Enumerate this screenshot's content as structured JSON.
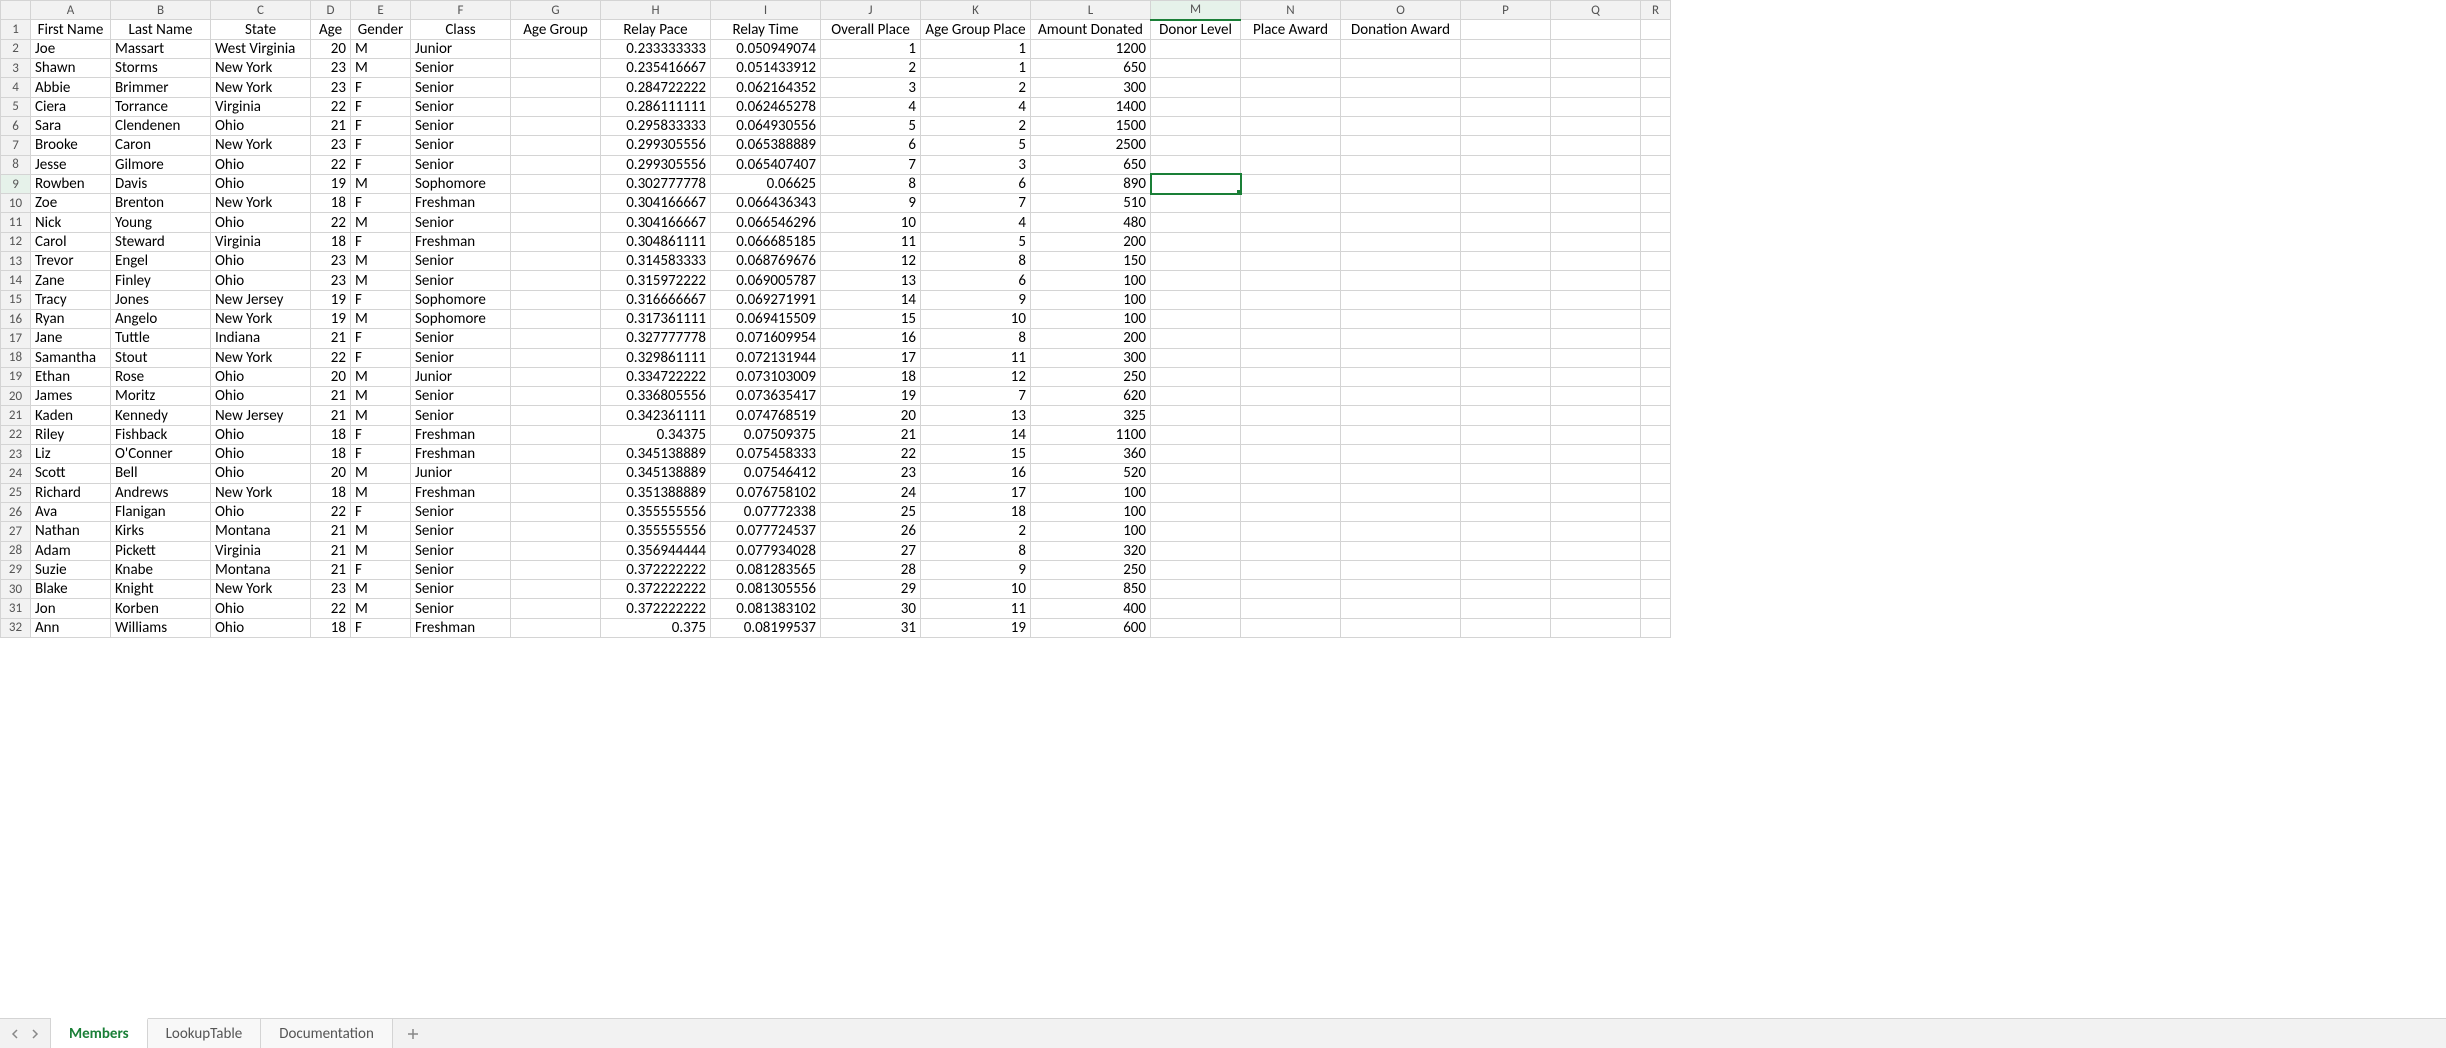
{
  "columns": [
    "A",
    "B",
    "C",
    "D",
    "E",
    "F",
    "G",
    "H",
    "I",
    "J",
    "K",
    "L",
    "M",
    "N",
    "O",
    "P",
    "Q",
    "R"
  ],
  "headers": {
    "A": "First Name",
    "B": "Last Name",
    "C": "State",
    "D": "Age",
    "E": "Gender",
    "F": "Class",
    "G": "Age Group",
    "H": "Relay Pace",
    "I": "Relay Time",
    "J": "Overall Place",
    "K": "Age Group Place",
    "L": "Amount Donated",
    "M": "Donor Level",
    "N": "Place Award",
    "O": "Donation Award",
    "P": "",
    "Q": "",
    "R": ""
  },
  "chart_data": {
    "type": "table",
    "columns": [
      "First Name",
      "Last Name",
      "State",
      "Age",
      "Gender",
      "Class",
      "Age Group",
      "Relay Pace",
      "Relay Time",
      "Overall Place",
      "Age Group Place",
      "Amount Donated",
      "Donor Level",
      "Place Award",
      "Donation Award"
    ],
    "rows": [
      [
        "Joe",
        "Massart",
        "West Virginia",
        20,
        "M",
        "Junior",
        "",
        0.233333333,
        0.050949074,
        1,
        1,
        1200,
        "",
        "",
        ""
      ],
      [
        "Shawn",
        "Storms",
        "New York",
        23,
        "M",
        "Senior",
        "",
        0.235416667,
        0.051433912,
        2,
        1,
        650,
        "",
        "",
        ""
      ],
      [
        "Abbie",
        "Brimmer",
        "New York",
        23,
        "F",
        "Senior",
        "",
        0.284722222,
        0.062164352,
        3,
        2,
        300,
        "",
        "",
        ""
      ],
      [
        "Ciera",
        "Torrance",
        "Virginia",
        22,
        "F",
        "Senior",
        "",
        0.286111111,
        0.062465278,
        4,
        4,
        1400,
        "",
        "",
        ""
      ],
      [
        "Sara",
        "Clendenen",
        "Ohio",
        21,
        "F",
        "Senior",
        "",
        0.295833333,
        0.064930556,
        5,
        2,
        1500,
        "",
        "",
        ""
      ],
      [
        "Brooke",
        "Caron",
        "New York",
        23,
        "F",
        "Senior",
        "",
        0.299305556,
        0.065388889,
        6,
        5,
        2500,
        "",
        "",
        ""
      ],
      [
        "Jesse",
        "Gilmore",
        "Ohio",
        22,
        "F",
        "Senior",
        "",
        0.299305556,
        0.065407407,
        7,
        3,
        650,
        "",
        "",
        ""
      ],
      [
        "Rowben",
        "Davis",
        "Ohio",
        19,
        "M",
        "Sophomore",
        "",
        0.302777778,
        0.06625,
        8,
        6,
        890,
        "",
        "",
        ""
      ],
      [
        "Zoe",
        "Brenton",
        "New York",
        18,
        "F",
        "Freshman",
        "",
        0.304166667,
        0.066436343,
        9,
        7,
        510,
        "",
        "",
        ""
      ],
      [
        "Nick",
        "Young",
        "Ohio",
        22,
        "M",
        "Senior",
        "",
        0.304166667,
        0.066546296,
        10,
        4,
        480,
        "",
        "",
        ""
      ],
      [
        "Carol",
        "Steward",
        "Virginia",
        18,
        "F",
        "Freshman",
        "",
        0.304861111,
        0.066685185,
        11,
        5,
        200,
        "",
        "",
        ""
      ],
      [
        "Trevor",
        "Engel",
        "Ohio",
        23,
        "M",
        "Senior",
        "",
        0.314583333,
        0.068769676,
        12,
        8,
        150,
        "",
        "",
        ""
      ],
      [
        "Zane",
        "Finley",
        "Ohio",
        23,
        "M",
        "Senior",
        "",
        0.315972222,
        0.069005787,
        13,
        6,
        100,
        "",
        "",
        ""
      ],
      [
        "Tracy",
        "Jones",
        "New Jersey",
        19,
        "F",
        "Sophomore",
        "",
        0.316666667,
        0.069271991,
        14,
        9,
        100,
        "",
        "",
        ""
      ],
      [
        "Ryan",
        "Angelo",
        "New York",
        19,
        "M",
        "Sophomore",
        "",
        0.317361111,
        0.069415509,
        15,
        10,
        100,
        "",
        "",
        ""
      ],
      [
        "Jane",
        "Tuttle",
        "Indiana",
        21,
        "F",
        "Senior",
        "",
        0.327777778,
        0.071609954,
        16,
        8,
        200,
        "",
        "",
        ""
      ],
      [
        "Samantha",
        "Stout",
        "New York",
        22,
        "F",
        "Senior",
        "",
        0.329861111,
        0.072131944,
        17,
        11,
        300,
        "",
        "",
        ""
      ],
      [
        "Ethan",
        "Rose",
        "Ohio",
        20,
        "M",
        "Junior",
        "",
        0.334722222,
        0.073103009,
        18,
        12,
        250,
        "",
        "",
        ""
      ],
      [
        "James",
        "Moritz",
        "Ohio",
        21,
        "M",
        "Senior",
        "",
        0.336805556,
        0.073635417,
        19,
        7,
        620,
        "",
        "",
        ""
      ],
      [
        "Kaden",
        "Kennedy",
        "New Jersey",
        21,
        "M",
        "Senior",
        "",
        0.342361111,
        0.074768519,
        20,
        13,
        325,
        "",
        "",
        ""
      ],
      [
        "Riley",
        "Fishback",
        "Ohio",
        18,
        "F",
        "Freshman",
        "",
        0.34375,
        0.07509375,
        21,
        14,
        1100,
        "",
        "",
        ""
      ],
      [
        "Liz",
        "O'Conner",
        "Ohio",
        18,
        "F",
        "Freshman",
        "",
        0.345138889,
        0.075458333,
        22,
        15,
        360,
        "",
        "",
        ""
      ],
      [
        "Scott",
        "Bell",
        "Ohio",
        20,
        "M",
        "Junior",
        "",
        0.345138889,
        0.07546412,
        23,
        16,
        520,
        "",
        "",
        ""
      ],
      [
        "Richard",
        "Andrews",
        "New York",
        18,
        "M",
        "Freshman",
        "",
        0.351388889,
        0.076758102,
        24,
        17,
        100,
        "",
        "",
        ""
      ],
      [
        "Ava",
        "Flanigan",
        "Ohio",
        22,
        "F",
        "Senior",
        "",
        0.355555556,
        0.07772338,
        25,
        18,
        100,
        "",
        "",
        ""
      ],
      [
        "Nathan",
        "Kirks",
        "Montana",
        21,
        "M",
        "Senior",
        "",
        0.355555556,
        0.077724537,
        26,
        2,
        100,
        "",
        "",
        ""
      ],
      [
        "Adam",
        "Pickett",
        "Virginia",
        21,
        "M",
        "Senior",
        "",
        0.356944444,
        0.077934028,
        27,
        8,
        320,
        "",
        "",
        ""
      ],
      [
        "Suzie",
        "Knabe",
        "Montana",
        21,
        "F",
        "Senior",
        "",
        0.372222222,
        0.081283565,
        28,
        9,
        250,
        "",
        "",
        ""
      ],
      [
        "Blake",
        "Knight",
        "New York",
        23,
        "M",
        "Senior",
        "",
        0.372222222,
        0.081305556,
        29,
        10,
        850,
        "",
        "",
        ""
      ],
      [
        "Jon",
        "Korben",
        "Ohio",
        22,
        "M",
        "Senior",
        "",
        0.372222222,
        0.081383102,
        30,
        11,
        400,
        "",
        "",
        ""
      ],
      [
        "Ann",
        "Williams",
        "Ohio",
        18,
        "F",
        "Freshman",
        "",
        0.375,
        0.08199537,
        31,
        19,
        600,
        "",
        "",
        ""
      ]
    ]
  },
  "selected": {
    "col": "M",
    "row": 9
  },
  "tabs": [
    {
      "label": "Members",
      "active": true
    },
    {
      "label": "LookupTable",
      "active": false
    },
    {
      "label": "Documentation",
      "active": false
    }
  ],
  "row_count": 32
}
